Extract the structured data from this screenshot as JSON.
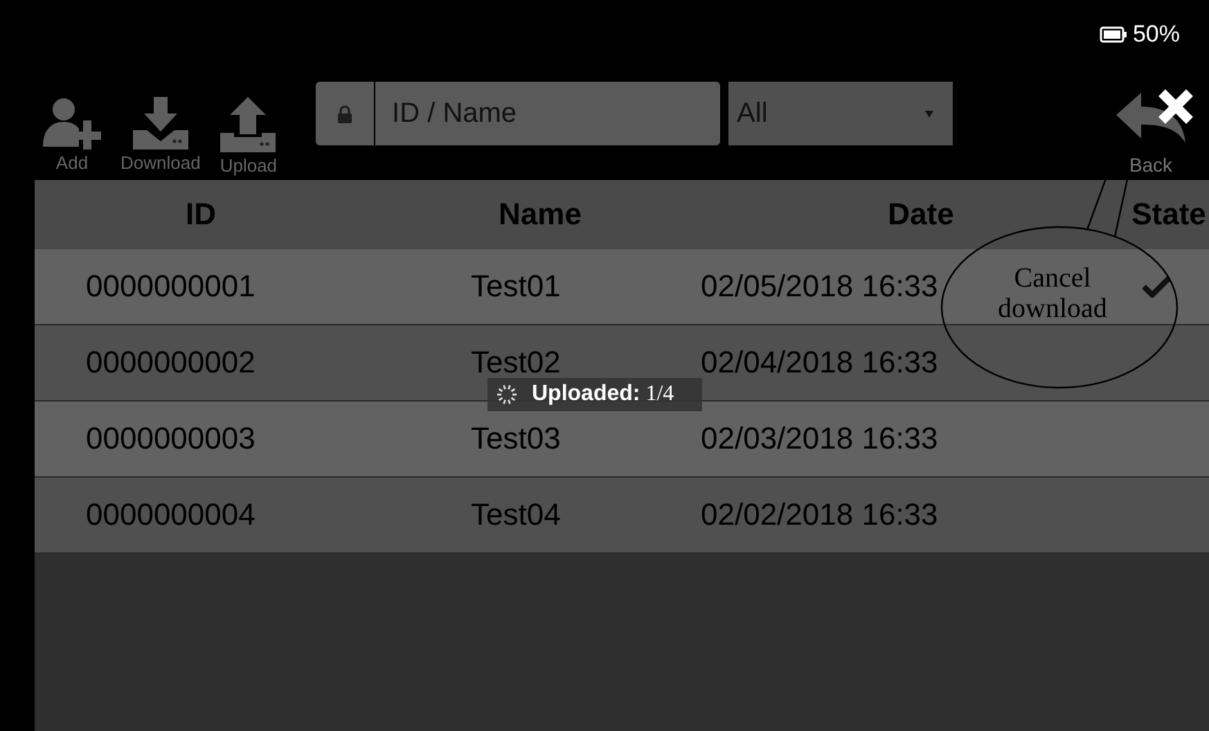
{
  "status_bar": {
    "battery": "50%"
  },
  "toolbar": {
    "buttons": [
      {
        "label": "Add",
        "kind": "add"
      },
      {
        "label": "Download",
        "kind": "download"
      },
      {
        "label": "Upload",
        "kind": "upload"
      }
    ],
    "search": {
      "placeholder": "ID / Name"
    },
    "filter": {
      "value": "All"
    },
    "back": {
      "label": "Back"
    }
  },
  "table": {
    "columns": [
      "ID",
      "Name",
      "Date",
      "State"
    ],
    "rows": [
      {
        "cells": [
          "0000000001",
          "Test01",
          "02/05/2018 16:33"
        ],
        "done": true
      },
      {
        "cells": [
          "0000000002",
          "Test02",
          "02/04/2018 16:33"
        ],
        "done": false
      },
      {
        "cells": [
          "0000000003",
          "Test03",
          "02/03/2018 16:33"
        ],
        "done": false
      },
      {
        "cells": [
          "0000000004",
          "Test04",
          "02/02/2018 16:33"
        ],
        "done": false
      }
    ]
  },
  "toast": {
    "text": "**Uploaded:** 1/4"
  },
  "annotation": {
    "text": "Cancel download"
  }
}
